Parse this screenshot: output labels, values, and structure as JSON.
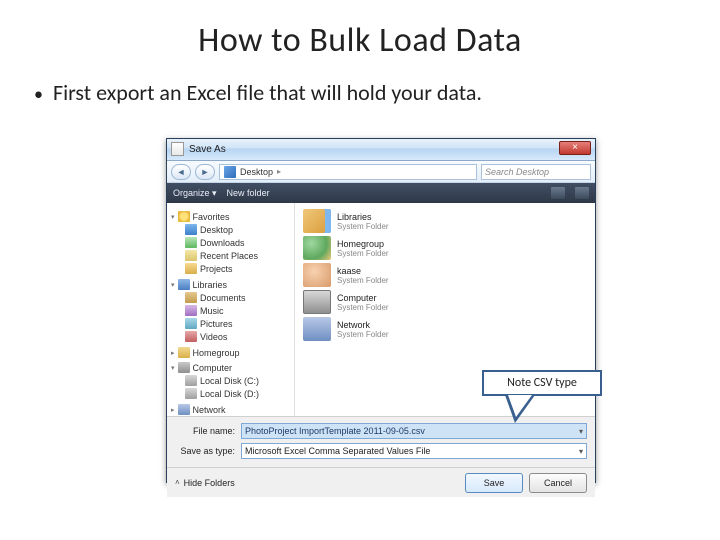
{
  "slide": {
    "title": "How to Bulk Load Data",
    "bullet": "First export an Excel file that will hold your data."
  },
  "dialog": {
    "title": "Save As",
    "close_glyph": "×",
    "nav": {
      "back_glyph": "◄",
      "fwd_glyph": "►",
      "breadcrumb_root": "Desktop",
      "search_placeholder": "Search Desktop"
    },
    "toolbar": {
      "organize": "Organize ▾",
      "new_folder": "New folder"
    },
    "sidebar": {
      "favorites": {
        "label": "Favorites",
        "items": [
          "Desktop",
          "Downloads",
          "Recent Places",
          "Projects"
        ]
      },
      "libraries": {
        "label": "Libraries",
        "items": [
          "Documents",
          "Music",
          "Pictures",
          "Videos"
        ]
      },
      "homegroup": {
        "label": "Homegroup"
      },
      "computer": {
        "label": "Computer",
        "items": [
          "Local Disk (C:)",
          "Local Disk (D:)"
        ]
      },
      "network": {
        "label": "Network"
      }
    },
    "main_items": [
      {
        "name": "Libraries",
        "sub": "System Folder"
      },
      {
        "name": "Homegroup",
        "sub": "System Folder"
      },
      {
        "name": "kaase",
        "sub": "System Folder"
      },
      {
        "name": "Computer",
        "sub": "System Folder"
      },
      {
        "name": "Network",
        "sub": "System Folder"
      }
    ],
    "callout": "Note CSV type",
    "fields": {
      "filename_label": "File name:",
      "filename_value": "PhotoProject ImportTemplate 2011-09-05.csv",
      "type_label": "Save as type:",
      "type_value": "Microsoft Excel Comma Separated Values File"
    },
    "footer": {
      "hide_folders": "Hide Folders",
      "save": "Save",
      "cancel": "Cancel"
    }
  }
}
